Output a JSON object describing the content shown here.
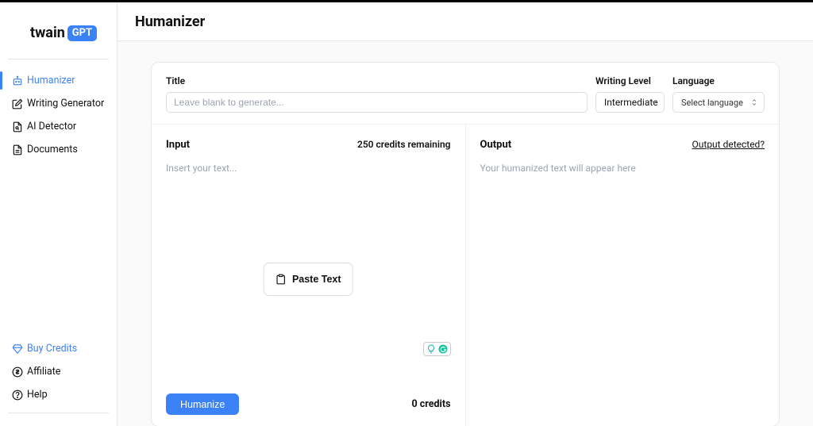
{
  "logo": {
    "text": "twain",
    "badge": "GPT"
  },
  "sidebar": {
    "items": [
      {
        "label": "Humanizer"
      },
      {
        "label": "Writing Generator"
      },
      {
        "label": "AI Detector"
      },
      {
        "label": "Documents"
      }
    ],
    "bottom": [
      {
        "label": "Buy Credits"
      },
      {
        "label": "Affiliate"
      },
      {
        "label": "Help"
      }
    ]
  },
  "header": {
    "title": "Humanizer"
  },
  "form": {
    "title_label": "Title",
    "title_placeholder": "Leave blank to generate...",
    "writing_level_label": "Writing Level",
    "writing_level_value": "Intermediate",
    "language_label": "Language",
    "language_value": "Select language"
  },
  "input": {
    "title": "Input",
    "credits_remaining": "250 credits remaining",
    "placeholder": "Insert your text...",
    "paste_label": "Paste Text",
    "humanize_label": "Humanize",
    "cost": "0 credits"
  },
  "output": {
    "title": "Output",
    "detected_label": "Output detected?",
    "placeholder": "Your humanized text will appear here"
  }
}
